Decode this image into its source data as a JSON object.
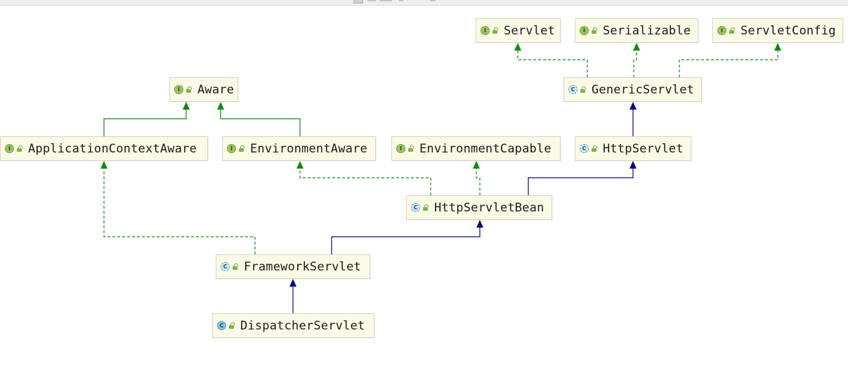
{
  "diagram": {
    "nodes": [
      {
        "id": "servlet",
        "name": "Servlet",
        "kind": "interface",
        "kind_glyph": "I"
      },
      {
        "id": "serializable",
        "name": "Serializable",
        "kind": "interface",
        "kind_glyph": "I"
      },
      {
        "id": "servlet_config",
        "name": "ServletConfig",
        "kind": "interface",
        "kind_glyph": "I"
      },
      {
        "id": "aware",
        "name": "Aware",
        "kind": "interface",
        "kind_glyph": "I"
      },
      {
        "id": "generic_servlet",
        "name": "GenericServlet",
        "kind": "abstract-class",
        "kind_glyph": "C"
      },
      {
        "id": "application_context_aware",
        "name": "ApplicationContextAware",
        "kind": "interface",
        "kind_glyph": "I"
      },
      {
        "id": "environment_aware",
        "name": "EnvironmentAware",
        "kind": "interface",
        "kind_glyph": "I"
      },
      {
        "id": "environment_capable",
        "name": "EnvironmentCapable",
        "kind": "interface",
        "kind_glyph": "I"
      },
      {
        "id": "http_servlet",
        "name": "HttpServlet",
        "kind": "abstract-class",
        "kind_glyph": "C"
      },
      {
        "id": "http_servlet_bean",
        "name": "HttpServletBean",
        "kind": "abstract-class",
        "kind_glyph": "C"
      },
      {
        "id": "framework_servlet",
        "name": "FrameworkServlet",
        "kind": "abstract-class",
        "kind_glyph": "C"
      },
      {
        "id": "dispatcher_servlet",
        "name": "DispatcherServlet",
        "kind": "class",
        "kind_glyph": "C"
      }
    ],
    "edges": [
      {
        "from": "generic_servlet",
        "to": "servlet",
        "type": "implements"
      },
      {
        "from": "generic_servlet",
        "to": "serializable",
        "type": "implements"
      },
      {
        "from": "generic_servlet",
        "to": "servlet_config",
        "type": "implements"
      },
      {
        "from": "application_context_aware",
        "to": "aware",
        "type": "extends-interface"
      },
      {
        "from": "environment_aware",
        "to": "aware",
        "type": "extends-interface"
      },
      {
        "from": "http_servlet",
        "to": "generic_servlet",
        "type": "extends"
      },
      {
        "from": "http_servlet_bean",
        "to": "environment_aware",
        "type": "implements"
      },
      {
        "from": "http_servlet_bean",
        "to": "environment_capable",
        "type": "implements"
      },
      {
        "from": "http_servlet_bean",
        "to": "http_servlet",
        "type": "extends"
      },
      {
        "from": "framework_servlet",
        "to": "application_context_aware",
        "type": "implements"
      },
      {
        "from": "framework_servlet",
        "to": "http_servlet_bean",
        "type": "extends"
      },
      {
        "from": "dispatcher_servlet",
        "to": "framework_servlet",
        "type": "extends"
      }
    ],
    "colors": {
      "implements": "#128a12",
      "extends-interface": "#128a12",
      "extends": "#0a0a7a",
      "node_fill": "#fafae6",
      "node_border": "#d6d6c2"
    }
  }
}
